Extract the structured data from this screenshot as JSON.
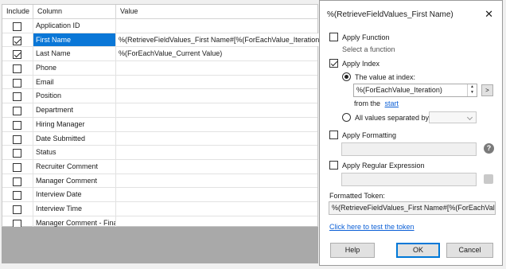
{
  "grid": {
    "headers": {
      "include": "Include",
      "column": "Column",
      "value": "Value"
    },
    "rows": [
      {
        "checked": false,
        "column": "Application ID",
        "value": ""
      },
      {
        "checked": true,
        "column": "First Name",
        "value": "%(RetrieveFieldValues_First Name#[%(ForEachValue_Iteration)]#)"
      },
      {
        "checked": true,
        "column": "Last Name",
        "value": "%(ForEachValue_Current Value)"
      },
      {
        "checked": false,
        "column": "Phone",
        "value": ""
      },
      {
        "checked": false,
        "column": "Email",
        "value": ""
      },
      {
        "checked": false,
        "column": "Position",
        "value": ""
      },
      {
        "checked": false,
        "column": "Department",
        "value": ""
      },
      {
        "checked": false,
        "column": "Hiring Manager",
        "value": ""
      },
      {
        "checked": false,
        "column": "Date Submitted",
        "value": ""
      },
      {
        "checked": false,
        "column": "Status",
        "value": ""
      },
      {
        "checked": false,
        "column": "Recruiter Comment",
        "value": ""
      },
      {
        "checked": false,
        "column": "Manager Comment",
        "value": ""
      },
      {
        "checked": false,
        "column": "Interview Date",
        "value": ""
      },
      {
        "checked": false,
        "column": "Interview Time",
        "value": ""
      },
      {
        "checked": false,
        "column": "Manager Comment - Final",
        "value": ""
      }
    ],
    "selected_row": 1,
    "selection_color": "#0a77d7"
  },
  "dialog": {
    "title": "%(RetrieveFieldValues_First Name)",
    "close_icon": "close-icon",
    "apply_function": {
      "label": "Apply Function",
      "checked": false,
      "hint": "Select a function"
    },
    "apply_index": {
      "label": "Apply Index",
      "checked": true,
      "value_at_index_label": "The value at index:",
      "value_at_index_selected": true,
      "index_value": "%(ForEachValue_Iteration)",
      "from_the_label": "from the",
      "start_link": "start",
      "all_values_label": "All values separated by:",
      "all_values_selected": false,
      "separator_value": ""
    },
    "apply_formatting": {
      "label": "Apply Formatting",
      "checked": false,
      "value": ""
    },
    "apply_regex": {
      "label": "Apply Regular Expression",
      "checked": false,
      "value": ""
    },
    "formatted_token_label": "Formatted Token:",
    "formatted_token_value": "%(RetrieveFieldValues_First Name#[%(ForEachValue_",
    "test_link": "Click here to test the token",
    "buttons": {
      "help": "Help",
      "ok": "OK",
      "cancel": "Cancel"
    },
    "accent_color": "#0078d7",
    "link_color": "#0b5fd6"
  }
}
